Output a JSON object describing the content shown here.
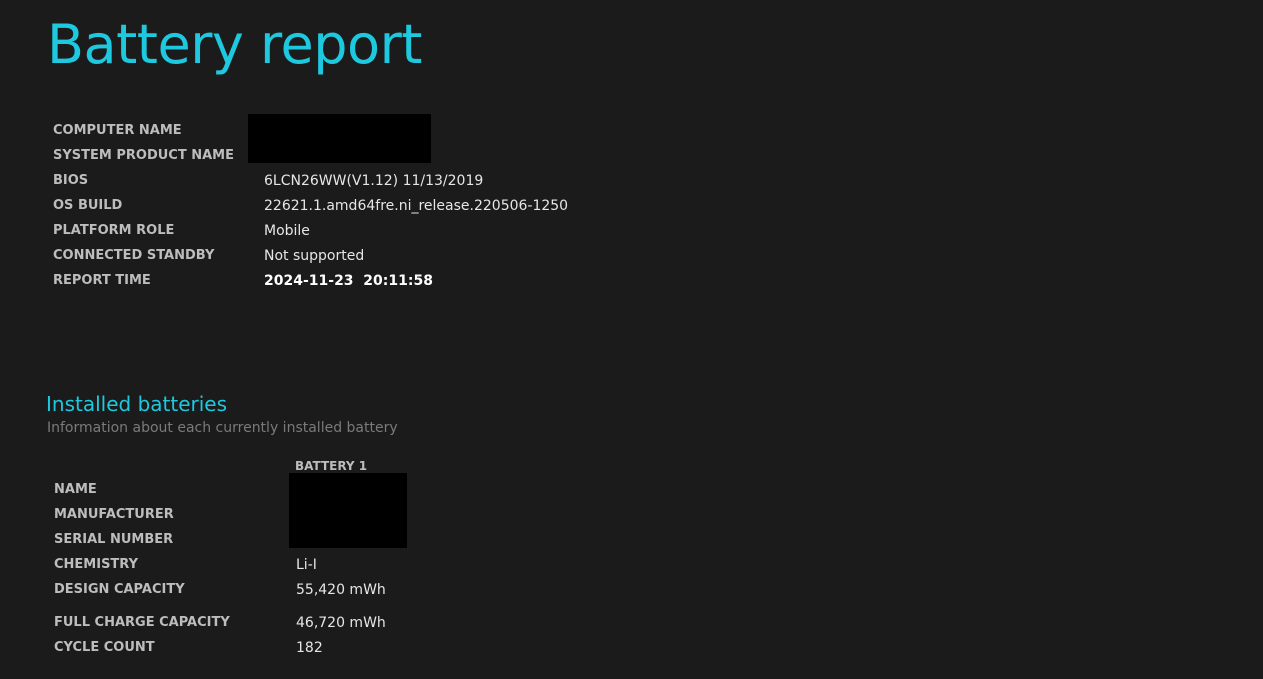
{
  "report": {
    "title": "Battery report"
  },
  "system_info": {
    "rows": [
      {
        "label": "COMPUTER NAME",
        "value": ""
      },
      {
        "label": "SYSTEM PRODUCT NAME",
        "value": ""
      },
      {
        "label": "BIOS",
        "value": "6LCN26WW(V1.12) 11/13/2019"
      },
      {
        "label": "OS BUILD",
        "value": "22621.1.amd64fre.ni_release.220506-1250"
      },
      {
        "label": "PLATFORM ROLE",
        "value": "Mobile"
      },
      {
        "label": "CONNECTED STANDBY",
        "value": "Not supported"
      },
      {
        "label": "REPORT TIME",
        "value": "2024-11-23  20:11:58"
      }
    ]
  },
  "installed_batteries": {
    "title": "Installed batteries",
    "subtitle": "Information about each currently installed battery",
    "column_header": "BATTERY 1",
    "rows": [
      {
        "label": "NAME",
        "value": ""
      },
      {
        "label": "MANUFACTURER",
        "value": ""
      },
      {
        "label": "SERIAL NUMBER",
        "value": ""
      },
      {
        "label": "CHEMISTRY",
        "value": "Li-I"
      },
      {
        "label": "DESIGN CAPACITY",
        "value": "55,420 mWh"
      },
      {
        "label": "FULL CHARGE CAPACITY",
        "value": "46,720 mWh"
      },
      {
        "label": "CYCLE COUNT",
        "value": "182"
      }
    ]
  },
  "colors": {
    "background": "#1b1b1b",
    "accent": "#1ec8de",
    "label": "#bdbdbd",
    "value": "#e6e6e6",
    "subtitle": "#7a7a7a",
    "redaction": "#000000"
  }
}
